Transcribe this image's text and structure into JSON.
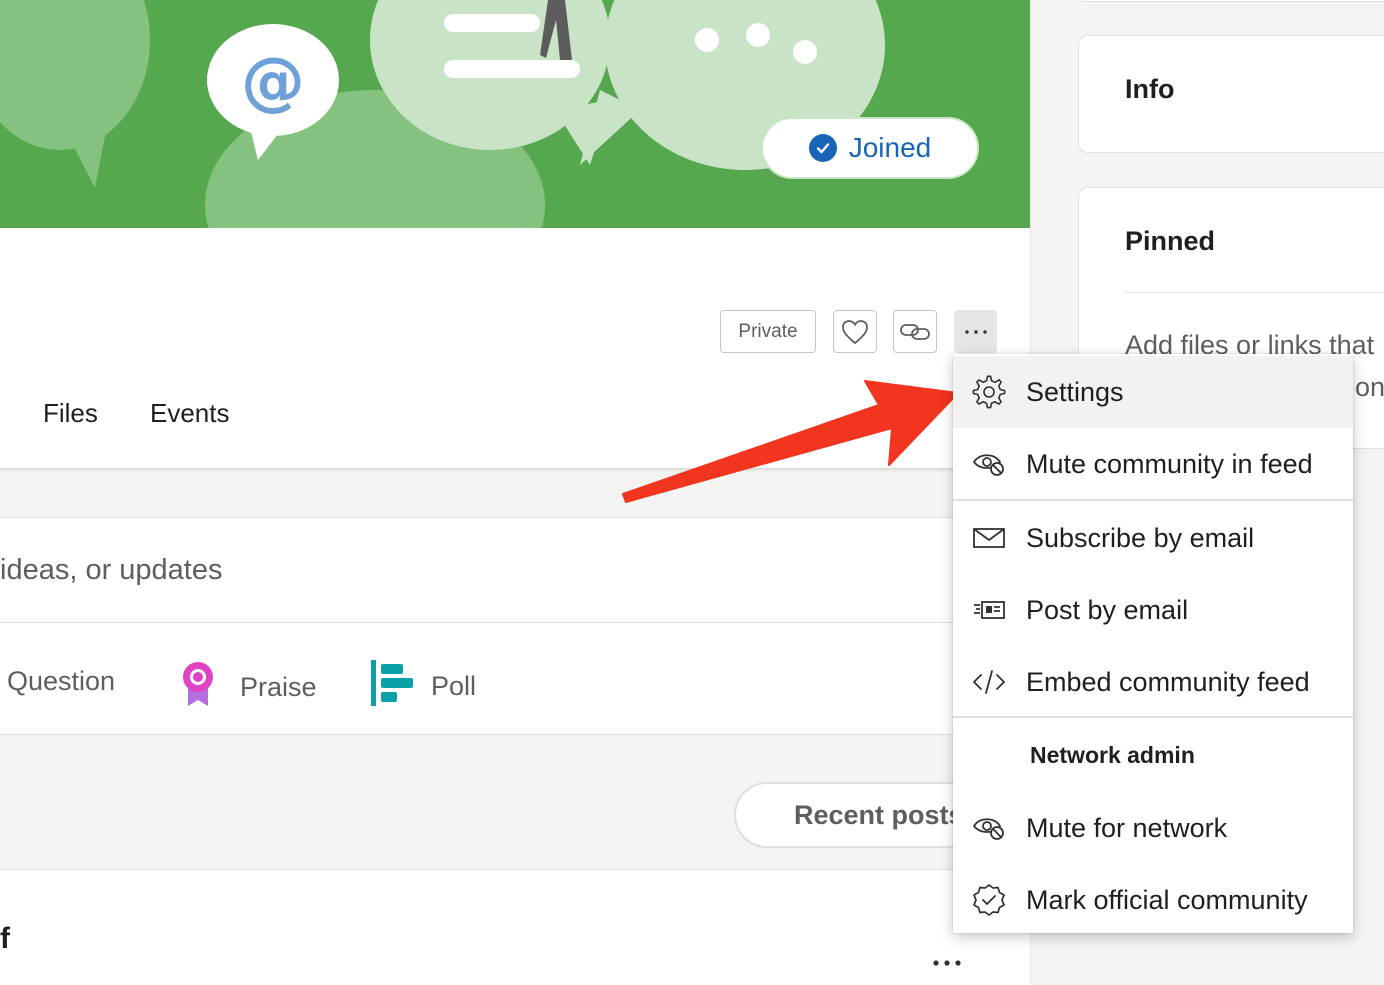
{
  "banner": {
    "joined_label": "Joined"
  },
  "header": {
    "privacy_label": "Private",
    "tabs": [
      "Files",
      "Events"
    ]
  },
  "composer": {
    "placeholder": "ideas, or updates",
    "post_types": [
      {
        "label": "Question",
        "icon": "question-icon"
      },
      {
        "label": "Praise",
        "icon": "praise-ribbon-icon"
      },
      {
        "label": "Poll",
        "icon": "poll-icon"
      }
    ]
  },
  "feed": {
    "sort_label": "Recent posts",
    "post_author_fragment": "f",
    "post_more": "..."
  },
  "sidebar": {
    "info_title": "Info",
    "pinned_title": "Pinned",
    "pinned_text": "Add files or links that",
    "pinned_text_2": "on"
  },
  "menu": {
    "items": [
      {
        "label": "Settings",
        "icon": "gear-icon"
      },
      {
        "label": "Mute community in feed",
        "icon": "mute-eye-icon"
      },
      {
        "label": "Subscribe by email",
        "icon": "envelope-icon"
      },
      {
        "label": "Post by email",
        "icon": "post-email-icon"
      },
      {
        "label": "Embed community feed",
        "icon": "code-icon"
      }
    ],
    "section_header": "Network admin",
    "admin_items": [
      {
        "label": "Mute for network",
        "icon": "mute-eye-icon"
      },
      {
        "label": "Mark official community",
        "icon": "verified-badge-icon"
      }
    ]
  },
  "colors": {
    "banner_green": "#56a84f",
    "accent_blue": "#1764b8",
    "arrow_red": "#f2351f",
    "praise_pink": "#e043c4",
    "poll_teal": "#0aa2a8"
  }
}
